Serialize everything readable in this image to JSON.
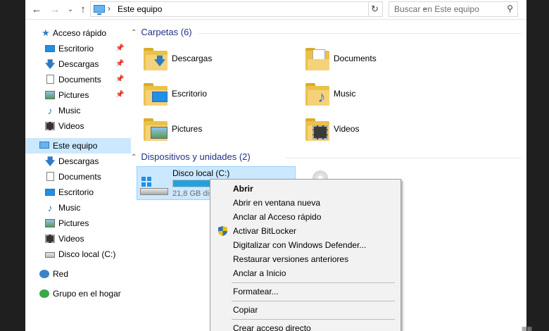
{
  "address_bar": {
    "back_icon": "arrow-left-icon",
    "forward_icon": "arrow-right-icon",
    "recent_icon": "chevron-down-icon",
    "up_icon": "arrow-up-icon",
    "location": "Este equipo",
    "search_placeholder": "Buscar en Este equipo"
  },
  "nav": {
    "quick_access": {
      "label": "Acceso rápido",
      "items": [
        {
          "label": "Escritorio",
          "icon": "desktop-icon",
          "pinned": true
        },
        {
          "label": "Descargas",
          "icon": "downloads-icon",
          "pinned": true
        },
        {
          "label": "Documents",
          "icon": "documents-icon",
          "pinned": true
        },
        {
          "label": "Pictures",
          "icon": "pictures-icon",
          "pinned": true
        },
        {
          "label": "Music",
          "icon": "music-icon",
          "pinned": false
        },
        {
          "label": "Videos",
          "icon": "videos-icon",
          "pinned": false
        }
      ]
    },
    "this_pc": {
      "label": "Este equipo",
      "items": [
        {
          "label": "Descargas",
          "icon": "downloads-icon"
        },
        {
          "label": "Documents",
          "icon": "documents-icon"
        },
        {
          "label": "Escritorio",
          "icon": "desktop-icon"
        },
        {
          "label": "Music",
          "icon": "music-icon"
        },
        {
          "label": "Pictures",
          "icon": "pictures-icon"
        },
        {
          "label": "Videos",
          "icon": "videos-icon"
        },
        {
          "label": "Disco local (C:)",
          "icon": "drive-icon"
        }
      ]
    },
    "network": "Red",
    "homegroup": "Grupo en el hogar"
  },
  "content": {
    "folders_header": "Carpetas (6)",
    "folders": [
      {
        "label": "Descargas",
        "icon": "downloads-folder-icon"
      },
      {
        "label": "Documents",
        "icon": "documents-folder-icon"
      },
      {
        "label": "Escritorio",
        "icon": "desktop-folder-icon"
      },
      {
        "label": "Music",
        "icon": "music-folder-icon"
      },
      {
        "label": "Pictures",
        "icon": "pictures-folder-icon"
      },
      {
        "label": "Videos",
        "icon": "videos-folder-icon"
      }
    ],
    "devices_header": "Dispositivos y unidades (2)",
    "drive": {
      "name": "Disco local (C:)",
      "free_text": "21,8 GB disp",
      "used_fraction": 0.62
    }
  },
  "context_menu": {
    "items": [
      {
        "label": "Abrir",
        "bold": true
      },
      {
        "label": "Abrir en ventana nueva"
      },
      {
        "label": "Anclar al Acceso rápido"
      },
      {
        "label": "Activar BitLocker",
        "icon": "uac-shield-icon"
      },
      {
        "label": "Digitalizar con Windows Defender..."
      },
      {
        "label": "Restaurar versiones anteriores"
      },
      {
        "label": "Anclar a Inicio"
      },
      {
        "label": "Formatear..."
      },
      {
        "label": "Copiar"
      },
      {
        "label": "Crear acceso directo"
      }
    ]
  },
  "colors": {
    "selection": "#cce8ff",
    "header_text": "#1e3287",
    "accent": "#26a0da"
  }
}
